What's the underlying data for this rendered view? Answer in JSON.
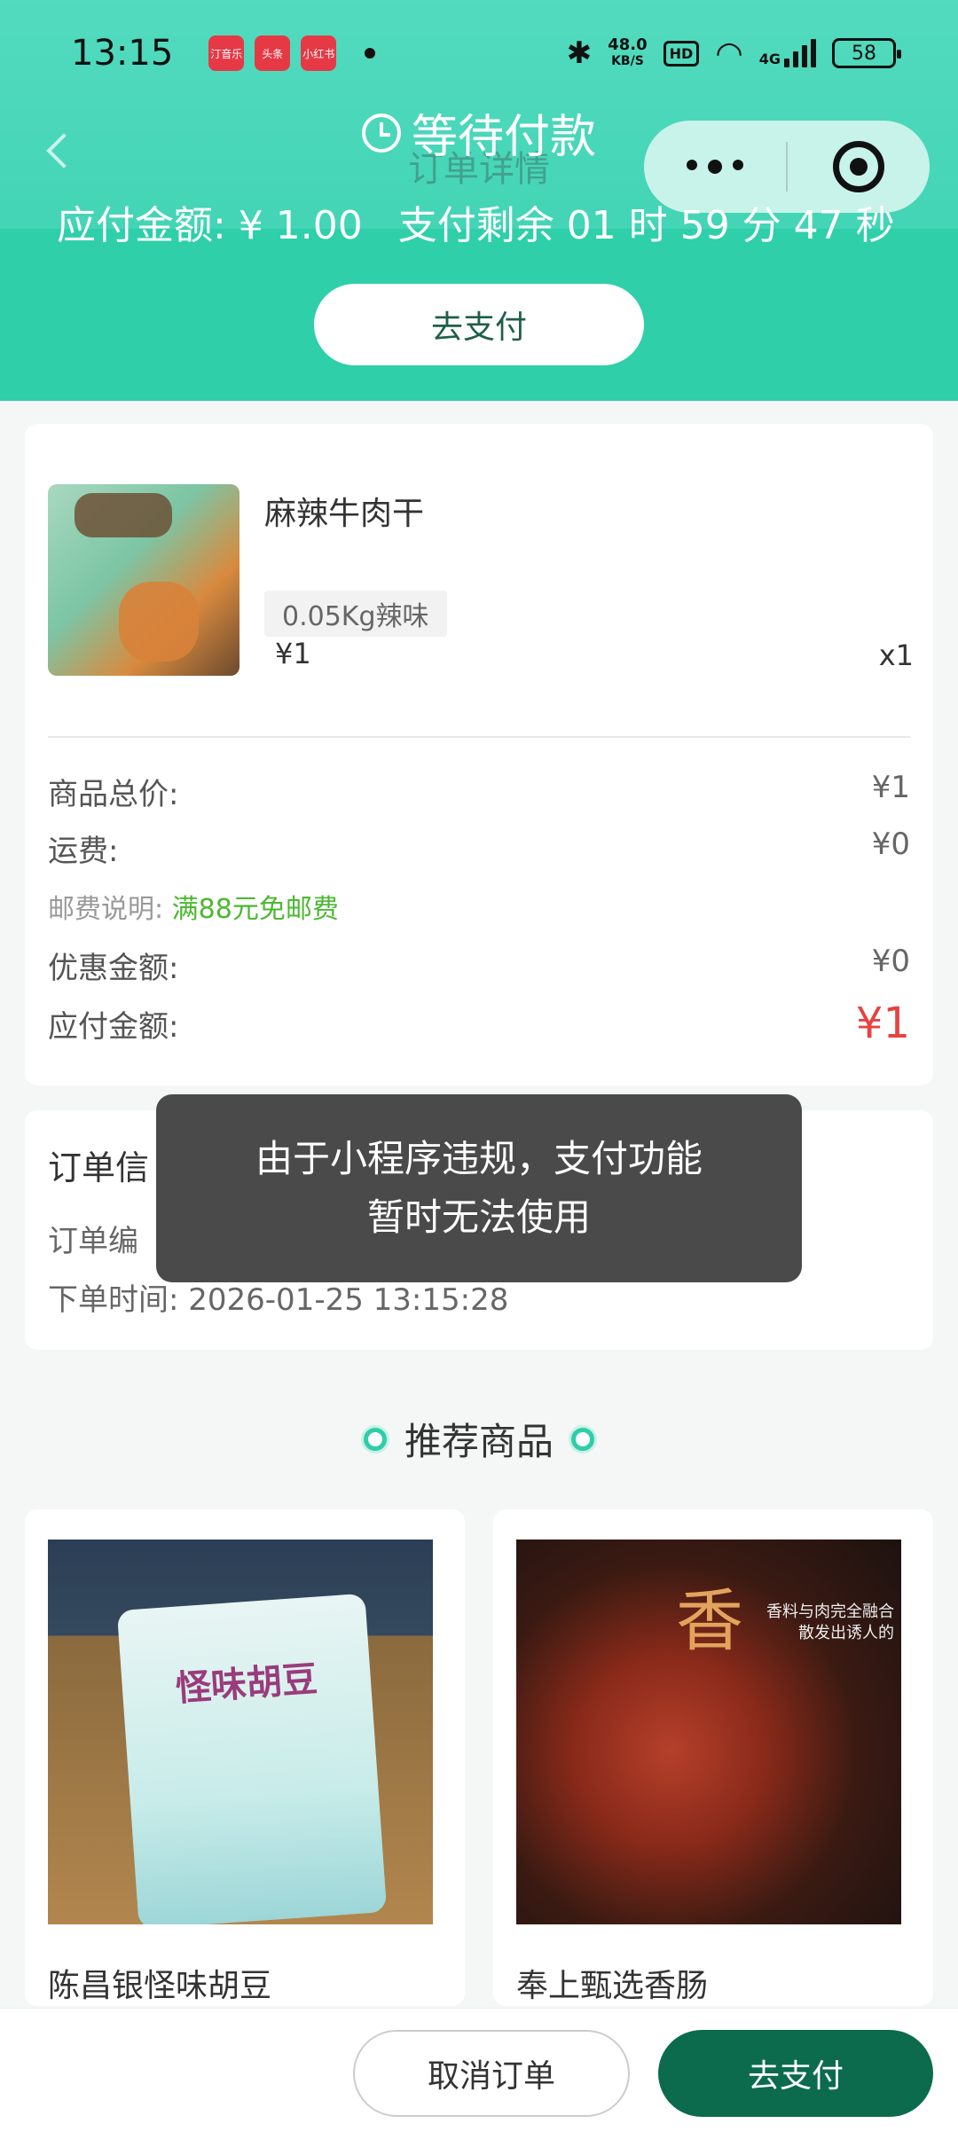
{
  "status_bar": {
    "time": "13:15",
    "notif_apps": [
      "汀音乐",
      "头条",
      "小红书"
    ],
    "net_speed_value": "48.0",
    "net_speed_unit": "KB/S",
    "hd": "HD",
    "network": "4G",
    "battery": "58"
  },
  "header": {
    "status_title": "等待付款",
    "nav_title": "订单详情",
    "amount_due_label": "应付金额: ¥ 1.00",
    "countdown": "支付剩余 01 时 59 分 47 秒",
    "pay_button": "去支付"
  },
  "product": {
    "name": "麻辣牛肉干",
    "spec": "0.05Kg辣味",
    "price": "¥1",
    "quantity": "x1"
  },
  "summary": {
    "goods_total_label": "商品总价:",
    "goods_total_value": "¥1",
    "shipping_label": "运费:",
    "shipping_value": "¥0",
    "postage_note_label": "邮费说明:",
    "postage_note_value": "满88元免邮费",
    "discount_label": "优惠金额:",
    "discount_value": "¥0",
    "due_label": "应付金额:",
    "due_value": "¥1"
  },
  "order_info": {
    "title": "订单信",
    "order_no_label": "订单编",
    "order_time": "下单时间: 2026-01-25 13:15:28"
  },
  "toast": {
    "line1": "由于小程序违规，支付功能",
    "line2": "暂时无法使用"
  },
  "recommend": {
    "title": "推荐商品",
    "items": [
      {
        "name": "陈昌银怪味胡豆",
        "package_text": "怪味胡豆"
      },
      {
        "name": "奉上甄选香肠",
        "package_text": "香",
        "caption": "香料与肉完全融合\n散发出诱人的"
      }
    ]
  },
  "bottom_bar": {
    "cancel_button": "取消订单",
    "pay_button": "去支付"
  },
  "colors": {
    "header_bg": "#2ecfa9",
    "pay_button_bg": "#0b6b4c",
    "price_red": "#e64340",
    "free_shipping_green": "#4cb832"
  }
}
